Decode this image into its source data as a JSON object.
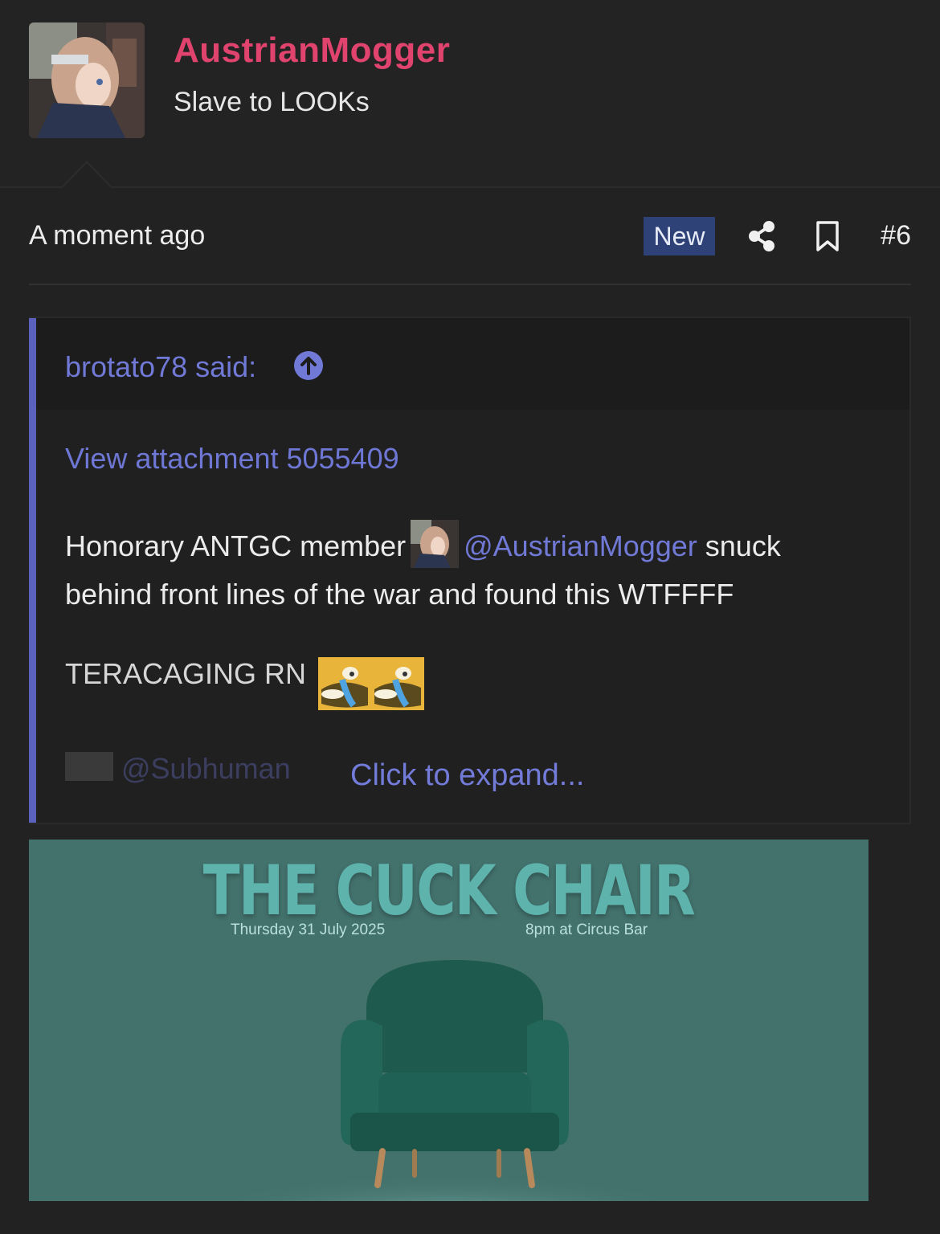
{
  "author": {
    "username": "AustrianMogger",
    "title": "Slave to LOOKs"
  },
  "post": {
    "time": "A moment ago",
    "badge": "New",
    "number": "#6"
  },
  "quote": {
    "author_said": "brotato78 said:",
    "attachment_link": "View attachment 5055409",
    "text_before_mention": "Honorary ANTGC member",
    "mention": "@AustrianMogger",
    "text_after_mention": " snuck behind front lines of the war and found this WTFFFF",
    "teracaging": "TERACAGING RN",
    "faded_mention": "@Subhuman",
    "expand": "Click to expand..."
  },
  "poster": {
    "title": "THE CUCK CHAIR",
    "date": "Thursday 31 July 2025",
    "venue": "8pm at Circus Bar"
  },
  "colors": {
    "username": "#e0446e",
    "link": "#7179d6",
    "badge_bg": "#2f4277",
    "quote_bar": "#5b62bd",
    "poster_bg": "#43716c"
  },
  "icons": [
    "share-icon",
    "bookmark-icon",
    "arrow-up-circle-icon"
  ]
}
